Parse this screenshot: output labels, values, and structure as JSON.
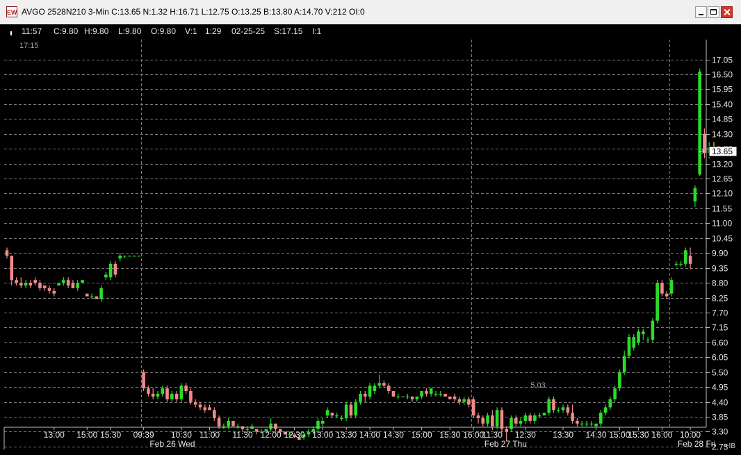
{
  "window": {
    "title": "AVGO 2528N210 3-Min C:13.65 N:1.32 H:16.71 L:12.75 O:13.25 B:13.80 A:14.70 V:212 OI:0",
    "app_icon_text": "EW"
  },
  "info_bar": {
    "time": "11:57",
    "close": "C:9.80",
    "high": "H:9.80",
    "low": "L:9.80",
    "open": "O:9.80",
    "volume": "V:1",
    "bar_time": "1:29",
    "date": "02-25-25",
    "strike": "S:17.15",
    "interval": "I:1"
  },
  "colors": {
    "up": "#2bdc2b",
    "down": "#f08a8a",
    "last": "#f2e82b",
    "grid": "#7a7a7a",
    "axis_text": "#e6e6e6",
    "annotation": "#a0a0a0"
  },
  "chart_data": {
    "type": "candlestick",
    "title": "AVGO 2528N210 3-Min",
    "strike_label": "17:15",
    "annotation_label": "5.03",
    "annotation_value": 5.03,
    "last_price_label": "13.65",
    "last_price": 13.65,
    "footer_mark": "+IB",
    "ylim": [
      2.5,
      17.15
    ],
    "y_ticks": [
      "17.05",
      "16.50",
      "15.95",
      "15.40",
      "14.85",
      "14.30",
      "13.75",
      "13.20",
      "12.65",
      "12.10",
      "11.55",
      "11.00",
      "10.45",
      "9.90",
      "9.35",
      "8.80",
      "8.25",
      "7.70",
      "7.15",
      "6.60",
      "6.05",
      "5.50",
      "4.95",
      "4.40",
      "3.85",
      "3.30",
      "2.75"
    ],
    "x_ticks": [
      {
        "label": "13:00",
        "i": 10
      },
      {
        "label": "15:00",
        "i": 17
      },
      {
        "label": "15:30",
        "i": 22
      },
      {
        "label": "09:39",
        "i": 29
      },
      {
        "label": "10:30",
        "i": 37
      },
      {
        "label": "11:00",
        "i": 43
      },
      {
        "label": "11:30",
        "i": 50
      },
      {
        "label": "12:00",
        "i": 56
      },
      {
        "label": "12:30",
        "i": 61
      },
      {
        "label": "13:00",
        "i": 67
      },
      {
        "label": "13:30",
        "i": 72
      },
      {
        "label": "14:00",
        "i": 77
      },
      {
        "label": "14:30",
        "i": 82
      },
      {
        "label": "15:00",
        "i": 88
      },
      {
        "label": "15:30",
        "i": 94
      },
      {
        "label": "16:00",
        "i": 99
      },
      {
        "label": "11:30",
        "i": 103
      },
      {
        "label": "12:30",
        "i": 110
      },
      {
        "label": "13:30",
        "i": 118
      },
      {
        "label": "14:30",
        "i": 125
      },
      {
        "label": "15:00",
        "i": 130
      },
      {
        "label": "15:30",
        "i": 134
      },
      {
        "label": "16:00",
        "i": 139
      },
      {
        "label": "10:00",
        "i": 145
      }
    ],
    "day_labels": [
      {
        "label": "Feb 26 Wed",
        "i": 30
      },
      {
        "label": "Feb 27 Thu",
        "i": 101
      },
      {
        "label": "Feb 28 Fri",
        "i": 142
      }
    ],
    "session_breaks": [
      29,
      99,
      141
    ],
    "candles": [
      {
        "o": 10.0,
        "h": 10.1,
        "l": 9.7,
        "c": 9.8
      },
      {
        "o": 9.8,
        "h": 9.8,
        "l": 8.7,
        "c": 8.9
      },
      {
        "o": 8.9,
        "h": 9.0,
        "l": 8.7,
        "c": 8.8
      },
      {
        "o": 8.8,
        "h": 9.0,
        "l": 8.6,
        "c": 8.7
      },
      {
        "o": 8.7,
        "h": 8.9,
        "l": 8.6,
        "c": 8.8
      },
      {
        "o": 8.8,
        "h": 8.9,
        "l": 8.6,
        "c": 8.7
      },
      {
        "o": 8.9,
        "h": 9.0,
        "l": 8.7,
        "c": 8.8
      },
      {
        "o": 8.8,
        "h": 8.9,
        "l": 8.5,
        "c": 8.6
      },
      {
        "o": 8.7,
        "h": 8.7,
        "l": 8.5,
        "c": 8.6
      },
      {
        "o": 8.6,
        "h": 8.7,
        "l": 8.4,
        "c": 8.5
      },
      {
        "o": 8.5,
        "h": 8.6,
        "l": 8.3,
        "c": 8.4
      },
      {
        "o": 8.7,
        "h": 8.8,
        "l": 8.7,
        "c": 8.8
      },
      {
        "o": 8.8,
        "h": 9.0,
        "l": 8.7,
        "c": 8.9
      },
      {
        "o": 8.9,
        "h": 9.0,
        "l": 8.6,
        "c": 8.7
      },
      {
        "o": 8.8,
        "h": 8.9,
        "l": 8.6,
        "c": 8.6
      },
      {
        "o": 8.6,
        "h": 8.9,
        "l": 8.5,
        "c": 8.8
      },
      {
        "o": 8.8,
        "h": 8.9,
        "l": 8.8,
        "c": 8.9
      },
      {
        "o": 8.4,
        "h": 8.4,
        "l": 8.3,
        "c": 8.3
      },
      {
        "o": 8.3,
        "h": 8.4,
        "l": 8.2,
        "c": 8.3
      },
      {
        "o": 8.3,
        "h": 8.3,
        "l": 8.2,
        "c": 8.2
      },
      {
        "o": 8.2,
        "h": 8.7,
        "l": 8.1,
        "c": 8.6
      },
      {
        "o": 9.0,
        "h": 9.2,
        "l": 8.9,
        "c": 9.1
      },
      {
        "o": 9.0,
        "h": 9.6,
        "l": 8.9,
        "c": 9.5
      },
      {
        "o": 9.5,
        "h": 9.6,
        "l": 9.0,
        "c": 9.1
      },
      {
        "o": 9.7,
        "h": 9.9,
        "l": 9.6,
        "c": 9.8
      },
      {
        "o": 9.8,
        "h": 9.8,
        "l": 9.7,
        "c": 9.8
      },
      {
        "o": 9.8,
        "h": 9.8,
        "l": 9.8,
        "c": 9.8
      },
      {
        "o": 9.8,
        "h": 9.8,
        "l": 9.8,
        "c": 9.8
      },
      {
        "o": 9.8,
        "h": 9.8,
        "l": 9.8,
        "c": 9.8
      },
      {
        "o": 5.5,
        "h": 5.6,
        "l": 4.8,
        "c": 4.9
      },
      {
        "o": 4.9,
        "h": 5.0,
        "l": 4.6,
        "c": 4.7
      },
      {
        "o": 4.7,
        "h": 4.9,
        "l": 4.5,
        "c": 4.6
      },
      {
        "o": 4.6,
        "h": 4.8,
        "l": 4.5,
        "c": 4.7
      },
      {
        "o": 4.7,
        "h": 5.0,
        "l": 4.6,
        "c": 4.9
      },
      {
        "o": 4.9,
        "h": 5.0,
        "l": 4.4,
        "c": 4.5
      },
      {
        "o": 4.5,
        "h": 4.8,
        "l": 4.4,
        "c": 4.7
      },
      {
        "o": 4.7,
        "h": 4.8,
        "l": 4.4,
        "c": 4.5
      },
      {
        "o": 4.5,
        "h": 5.1,
        "l": 4.4,
        "c": 5.0
      },
      {
        "o": 5.0,
        "h": 5.1,
        "l": 4.7,
        "c": 4.8
      },
      {
        "o": 4.8,
        "h": 4.9,
        "l": 4.3,
        "c": 4.4
      },
      {
        "o": 4.4,
        "h": 4.5,
        "l": 4.2,
        "c": 4.3
      },
      {
        "o": 4.3,
        "h": 4.4,
        "l": 4.1,
        "c": 4.2
      },
      {
        "o": 4.2,
        "h": 4.3,
        "l": 4.0,
        "c": 4.1
      },
      {
        "o": 4.2,
        "h": 4.3,
        "l": 4.1,
        "c": 4.1
      },
      {
        "o": 4.1,
        "h": 4.2,
        "l": 3.7,
        "c": 3.8
      },
      {
        "o": 3.8,
        "h": 3.9,
        "l": 3.4,
        "c": 3.5
      },
      {
        "o": 3.5,
        "h": 3.6,
        "l": 3.4,
        "c": 3.5
      },
      {
        "o": 3.5,
        "h": 3.8,
        "l": 3.4,
        "c": 3.7
      },
      {
        "o": 3.7,
        "h": 3.7,
        "l": 3.5,
        "c": 3.5
      },
      {
        "o": 3.5,
        "h": 3.6,
        "l": 3.4,
        "c": 3.5
      },
      {
        "o": 3.5,
        "h": 3.5,
        "l": 3.3,
        "c": 3.4
      },
      {
        "o": 3.4,
        "h": 3.5,
        "l": 3.3,
        "c": 3.4
      },
      {
        "o": 3.4,
        "h": 3.6,
        "l": 3.4,
        "c": 3.5
      },
      {
        "o": 3.4,
        "h": 3.4,
        "l": 3.2,
        "c": 3.3
      },
      {
        "o": 3.3,
        "h": 3.4,
        "l": 3.3,
        "c": 3.3
      },
      {
        "o": 3.3,
        "h": 3.4,
        "l": 3.3,
        "c": 3.4
      },
      {
        "o": 3.4,
        "h": 3.8,
        "l": 3.3,
        "c": 3.6
      },
      {
        "o": 3.6,
        "h": 3.6,
        "l": 3.3,
        "c": 3.4
      },
      {
        "o": 3.4,
        "h": 3.4,
        "l": 3.2,
        "c": 3.3
      },
      {
        "o": 3.3,
        "h": 3.3,
        "l": 3.2,
        "c": 3.2
      },
      {
        "o": 3.2,
        "h": 3.3,
        "l": 3.1,
        "c": 3.2
      },
      {
        "o": 3.2,
        "h": 3.2,
        "l": 3.1,
        "c": 3.1
      },
      {
        "o": 3.1,
        "h": 3.2,
        "l": 3.0,
        "c": 3.0
      },
      {
        "o": 3.1,
        "h": 3.2,
        "l": 3.0,
        "c": 3.2
      },
      {
        "o": 3.2,
        "h": 3.4,
        "l": 3.1,
        "c": 3.3
      },
      {
        "o": 3.3,
        "h": 3.5,
        "l": 3.2,
        "c": 3.4
      },
      {
        "o": 3.4,
        "h": 3.8,
        "l": 3.3,
        "c": 3.7
      },
      {
        "o": 3.6,
        "h": 3.8,
        "l": 3.5,
        "c": 3.7
      },
      {
        "o": 3.9,
        "h": 4.2,
        "l": 3.8,
        "c": 4.1
      },
      {
        "o": 4.0,
        "h": 4.0,
        "l": 3.8,
        "c": 3.9
      },
      {
        "o": 3.9,
        "h": 4.0,
        "l": 3.8,
        "c": 3.9
      },
      {
        "o": 3.8,
        "h": 3.9,
        "l": 3.7,
        "c": 3.8
      },
      {
        "o": 3.8,
        "h": 4.4,
        "l": 3.7,
        "c": 4.3
      },
      {
        "o": 4.3,
        "h": 4.4,
        "l": 3.8,
        "c": 3.9
      },
      {
        "o": 3.9,
        "h": 4.5,
        "l": 3.8,
        "c": 4.4
      },
      {
        "o": 4.4,
        "h": 4.8,
        "l": 4.3,
        "c": 4.7
      },
      {
        "o": 4.7,
        "h": 4.8,
        "l": 4.4,
        "c": 4.6
      },
      {
        "o": 4.6,
        "h": 5.1,
        "l": 4.5,
        "c": 5.0
      },
      {
        "o": 4.8,
        "h": 5.1,
        "l": 4.7,
        "c": 5.0
      },
      {
        "o": 5.0,
        "h": 5.4,
        "l": 4.9,
        "c": 5.1
      },
      {
        "o": 5.1,
        "h": 5.2,
        "l": 4.9,
        "c": 5.0
      },
      {
        "o": 5.0,
        "h": 5.1,
        "l": 4.7,
        "c": 4.8
      },
      {
        "o": 4.8,
        "h": 4.8,
        "l": 4.6,
        "c": 4.6
      },
      {
        "o": 4.6,
        "h": 4.7,
        "l": 4.5,
        "c": 4.6
      },
      {
        "o": 4.6,
        "h": 4.6,
        "l": 4.6,
        "c": 4.6
      },
      {
        "o": 4.6,
        "h": 4.7,
        "l": 4.5,
        "c": 4.6
      },
      {
        "o": 4.6,
        "h": 4.6,
        "l": 4.4,
        "c": 4.5
      },
      {
        "o": 4.5,
        "h": 4.6,
        "l": 4.4,
        "c": 4.6
      },
      {
        "o": 4.6,
        "h": 4.8,
        "l": 4.5,
        "c": 4.8
      },
      {
        "o": 4.8,
        "h": 4.9,
        "l": 4.6,
        "c": 4.7
      },
      {
        "o": 4.7,
        "h": 4.9,
        "l": 4.6,
        "c": 4.9
      },
      {
        "o": 4.7,
        "h": 4.8,
        "l": 4.6,
        "c": 4.7
      },
      {
        "o": 4.7,
        "h": 4.8,
        "l": 4.6,
        "c": 4.7
      },
      {
        "o": 4.7,
        "h": 4.7,
        "l": 4.6,
        "c": 4.6
      },
      {
        "o": 4.6,
        "h": 4.6,
        "l": 4.5,
        "c": 4.5
      },
      {
        "o": 4.6,
        "h": 4.7,
        "l": 4.4,
        "c": 4.5
      },
      {
        "o": 4.5,
        "h": 4.6,
        "l": 4.3,
        "c": 4.4
      },
      {
        "o": 4.4,
        "h": 4.6,
        "l": 4.3,
        "c": 4.5
      },
      {
        "o": 4.5,
        "h": 4.6,
        "l": 4.2,
        "c": 4.3
      },
      {
        "o": 4.5,
        "h": 4.6,
        "l": 3.8,
        "c": 3.9
      },
      {
        "o": 3.9,
        "h": 4.0,
        "l": 3.6,
        "c": 3.8
      },
      {
        "o": 3.8,
        "h": 3.9,
        "l": 3.5,
        "c": 3.6
      },
      {
        "o": 3.6,
        "h": 4.0,
        "l": 3.5,
        "c": 3.9
      },
      {
        "o": 3.9,
        "h": 4.1,
        "l": 3.4,
        "c": 3.5
      },
      {
        "o": 3.5,
        "h": 4.2,
        "l": 3.4,
        "c": 4.1
      },
      {
        "o": 4.1,
        "h": 4.2,
        "l": 3.3,
        "c": 3.4
      },
      {
        "o": 3.4,
        "h": 3.5,
        "l": 2.95,
        "c": 3.3
      },
      {
        "o": 3.4,
        "h": 3.9,
        "l": 3.3,
        "c": 3.8
      },
      {
        "o": 3.8,
        "h": 3.9,
        "l": 3.5,
        "c": 3.6
      },
      {
        "o": 3.6,
        "h": 3.8,
        "l": 3.5,
        "c": 3.7
      },
      {
        "o": 3.7,
        "h": 4.0,
        "l": 3.6,
        "c": 3.9
      },
      {
        "o": 3.9,
        "h": 4.0,
        "l": 3.6,
        "c": 3.7
      },
      {
        "o": 3.7,
        "h": 4.0,
        "l": 3.6,
        "c": 3.9
      },
      {
        "o": 3.9,
        "h": 4.0,
        "l": 3.8,
        "c": 3.9
      },
      {
        "o": 3.9,
        "h": 4.0,
        "l": 3.9,
        "c": 4.0
      },
      {
        "o": 4.0,
        "h": 4.6,
        "l": 3.9,
        "c": 4.5
      },
      {
        "o": 4.5,
        "h": 4.6,
        "l": 4.0,
        "c": 4.1
      },
      {
        "o": 4.1,
        "h": 4.2,
        "l": 4.0,
        "c": 4.1
      },
      {
        "o": 4.1,
        "h": 4.3,
        "l": 4.0,
        "c": 4.2
      },
      {
        "o": 4.2,
        "h": 4.3,
        "l": 3.9,
        "c": 4.0
      },
      {
        "o": 4.0,
        "h": 4.3,
        "l": 3.6,
        "c": 3.7
      },
      {
        "o": 3.7,
        "h": 3.8,
        "l": 3.5,
        "c": 3.6
      },
      {
        "o": 3.6,
        "h": 3.7,
        "l": 3.5,
        "c": 3.6
      },
      {
        "o": 3.6,
        "h": 3.7,
        "l": 3.5,
        "c": 3.6
      },
      {
        "o": 3.6,
        "h": 3.7,
        "l": 3.5,
        "c": 3.6
      },
      {
        "o": 3.5,
        "h": 3.6,
        "l": 3.5,
        "c": 3.6
      },
      {
        "o": 3.6,
        "h": 4.1,
        "l": 3.5,
        "c": 4.0
      },
      {
        "o": 4.0,
        "h": 4.3,
        "l": 3.9,
        "c": 4.2
      },
      {
        "o": 4.2,
        "h": 4.6,
        "l": 4.1,
        "c": 4.5
      },
      {
        "o": 4.5,
        "h": 5.0,
        "l": 4.4,
        "c": 4.9
      },
      {
        "o": 4.9,
        "h": 5.6,
        "l": 4.8,
        "c": 5.5
      },
      {
        "o": 5.5,
        "h": 6.3,
        "l": 5.4,
        "c": 6.1
      },
      {
        "o": 6.1,
        "h": 6.9,
        "l": 6.0,
        "c": 6.8
      },
      {
        "o": 6.4,
        "h": 6.9,
        "l": 6.3,
        "c": 6.8
      },
      {
        "o": 6.6,
        "h": 7.1,
        "l": 6.5,
        "c": 7.0
      },
      {
        "o": 6.9,
        "h": 7.1,
        "l": 6.7,
        "c": 7.0
      },
      {
        "o": 6.7,
        "h": 6.8,
        "l": 6.6,
        "c": 6.7
      },
      {
        "o": 6.7,
        "h": 7.5,
        "l": 6.6,
        "c": 7.4
      },
      {
        "o": 7.4,
        "h": 8.9,
        "l": 7.3,
        "c": 8.8
      },
      {
        "o": 8.8,
        "h": 8.9,
        "l": 8.3,
        "c": 8.4
      },
      {
        "o": 8.4,
        "h": 8.5,
        "l": 8.2,
        "c": 8.3
      },
      {
        "o": 8.4,
        "h": 9.0,
        "l": 8.3,
        "c": 8.9
      },
      {
        "o": 9.5,
        "h": 9.6,
        "l": 9.4,
        "c": 9.5
      },
      {
        "o": 9.5,
        "h": 9.6,
        "l": 9.4,
        "c": 9.5
      },
      {
        "o": 9.5,
        "h": 10.1,
        "l": 9.4,
        "c": 10.0
      },
      {
        "o": 9.8,
        "h": 10.1,
        "l": 9.3,
        "c": 9.5
      },
      {
        "o": 11.8,
        "h": 12.4,
        "l": 11.6,
        "c": 12.3
      },
      {
        "o": 12.8,
        "h": 16.71,
        "l": 12.75,
        "c": 16.6
      },
      {
        "o": 14.3,
        "h": 14.5,
        "l": 13.4,
        "c": 13.6
      },
      {
        "o": 13.6,
        "h": 14.0,
        "l": 13.4,
        "c": 13.8
      },
      {
        "o": 13.8,
        "h": 14.0,
        "l": 13.5,
        "c": 13.65
      }
    ]
  }
}
